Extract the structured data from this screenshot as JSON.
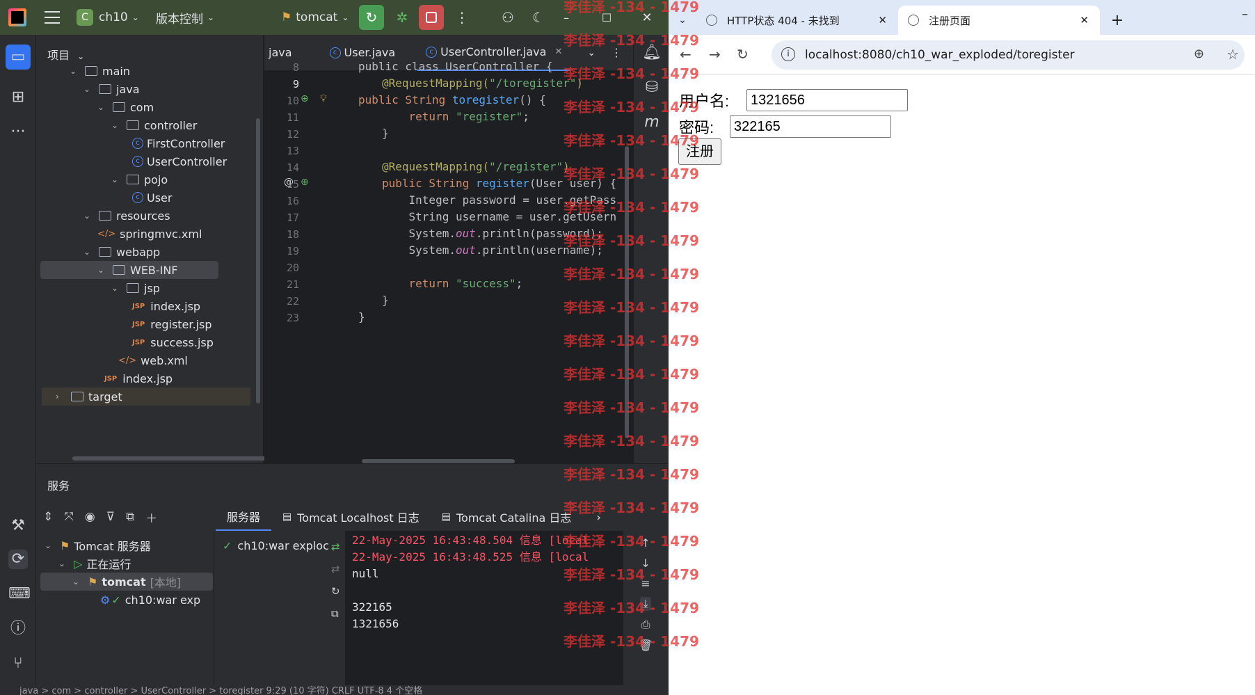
{
  "ide": {
    "project_name": "ch10",
    "project_badge": "C",
    "vcs_label": "版本控制",
    "run_config": "tomcat",
    "project_panel_title": "项目",
    "tree": [
      {
        "label": "main",
        "kind": "folder"
      },
      {
        "label": "java",
        "kind": "folder"
      },
      {
        "label": "com",
        "kind": "package"
      },
      {
        "label": "controller",
        "kind": "package"
      },
      {
        "label": "FirstController",
        "kind": "class"
      },
      {
        "label": "UserController",
        "kind": "class"
      },
      {
        "label": "pojo",
        "kind": "package"
      },
      {
        "label": "User",
        "kind": "class"
      },
      {
        "label": "resources",
        "kind": "folder"
      },
      {
        "label": "springmvc.xml",
        "kind": "xml"
      },
      {
        "label": "webapp",
        "kind": "folder"
      },
      {
        "label": "WEB-INF",
        "kind": "folder"
      },
      {
        "label": "jsp",
        "kind": "folder"
      },
      {
        "label": "index.jsp",
        "kind": "jsp"
      },
      {
        "label": "register.jsp",
        "kind": "jsp"
      },
      {
        "label": "success.jsp",
        "kind": "jsp"
      },
      {
        "label": "web.xml",
        "kind": "xml"
      },
      {
        "label": "index.jsp",
        "kind": "jsp"
      },
      {
        "label": "target",
        "kind": "folder"
      }
    ],
    "editor_tabs": [
      "java",
      "User.java",
      "UserController.java"
    ],
    "line_numbers": [
      "8",
      "9",
      "10",
      "11",
      "12",
      "13",
      "14",
      "15",
      "16",
      "17",
      "18",
      "19",
      "20",
      "21",
      "22",
      "23"
    ],
    "code": {
      "l8": "public class UserController {",
      "l9a": "@RequestMapping(",
      "l9b": "\"/toregister\"",
      "l9c": ")",
      "l10a": "public String ",
      "l10b": "toregister",
      "l10c": "() {",
      "l11a": "    return ",
      "l11b": "\"register\"",
      "l11c": ";",
      "l12": "}",
      "l14a": "@RequestMapping(",
      "l14b": "\"/register\"",
      "l14c": ")",
      "l15a": "public String ",
      "l15b": "register",
      "l15c": "(User user) {",
      "l16": "    Integer password = user.getPass",
      "l17": "    String username = user.getUsern",
      "l18a": "    System.",
      "l18b": "out",
      "l18c": ".println(password);",
      "l19a": "    System.",
      "l19b": "out",
      "l19c": ".println(username);",
      "l21a": "    return ",
      "l21b": "\"success\"",
      "l21c": ";",
      "l22": "}",
      "l23": "}"
    },
    "services": {
      "title": "服务",
      "tree": {
        "root": "Tomcat 服务器",
        "running": "正在运行",
        "server": "tomcat",
        "server_tag": "[本地]",
        "artifact": "ch10:war exp"
      },
      "deploy_item": "ch10:war exploc",
      "tabs": [
        "服务器",
        "Tomcat Localhost 日志",
        "Tomcat Catalina 日志"
      ],
      "console": [
        {
          "text": "22-May-2025 16:43:48.504 信息 [local",
          "color": "red"
        },
        {
          "text": "22-May-2025 16:43:48.525 信息 [local",
          "color": "red"
        },
        {
          "text": "null",
          "color": "normal"
        },
        {
          "text": "",
          "color": "normal"
        },
        {
          "text": "322165",
          "color": "normal"
        },
        {
          "text": "1321656",
          "color": "normal"
        }
      ]
    },
    "statusbar": "java  >  com  >  controller  >  UserController  >  toregister        9:29 (10 字符)    CRLF    UTF-8    4 个空格"
  },
  "browser": {
    "tabs": [
      {
        "title": "HTTP状态 404 - 未找到"
      },
      {
        "title": "注册页面"
      }
    ],
    "url": "localhost:8080/ch10_war_exploded/toregister",
    "form": {
      "username_label": "用户名:",
      "username_value": "1321656",
      "password_label": "密码:",
      "password_value": "322165",
      "submit_label": "注册"
    }
  },
  "watermark": "李佳泽 -134 - 1479",
  "colors": {
    "accent": "#548af7",
    "title_bar": "#3c4b33",
    "run_green": "#499c54",
    "stop_red": "#c94f4f",
    "watermark": "#e63232"
  }
}
